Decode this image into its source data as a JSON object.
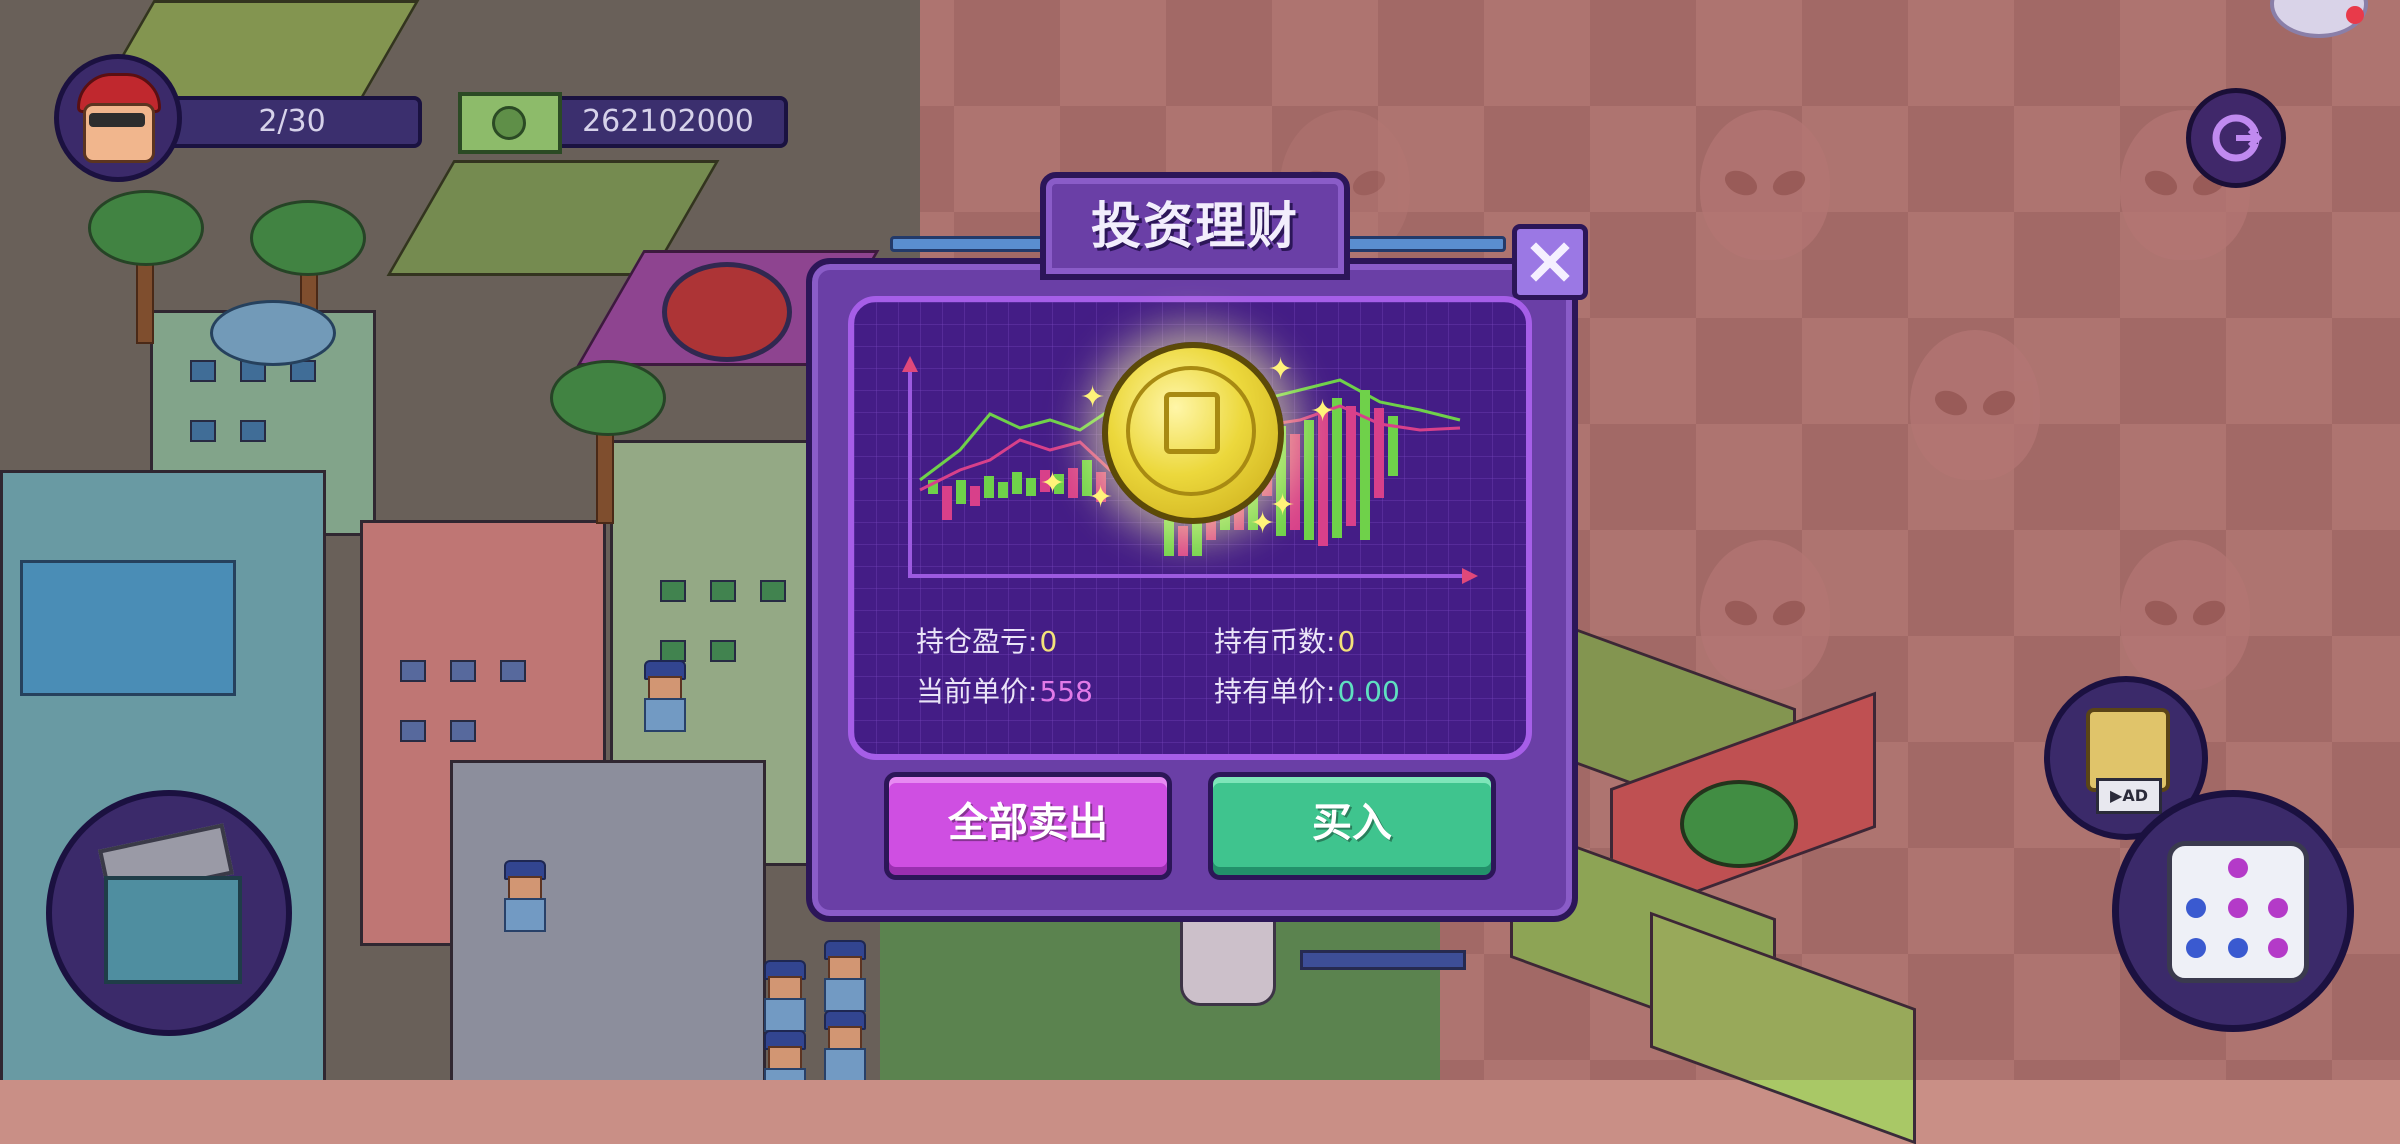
{
  "hud": {
    "turns": "2/30",
    "money": "262102000"
  },
  "dialog": {
    "title": "投资理财",
    "stats": {
      "pnl_label": "持仓盈亏:",
      "pnl_value": "0",
      "coins_label": "持有币数:",
      "coins_value": "0",
      "price_label": "当前单价:",
      "price_value": "558",
      "avg_label": "持有单价:",
      "avg_value": "0.00"
    },
    "sell_all_label": "全部卖出",
    "buy_label": "买入"
  },
  "colors": {
    "panel": "#441d86",
    "sell": "#cf4fe2",
    "buy": "#3fc48e",
    "pnl": "#f3e27a",
    "price": "#e27ae8",
    "avg": "#5fe0c0"
  },
  "icons": {
    "avatar": "player-avatar",
    "money": "cash-icon",
    "exit": "exit-icon",
    "close": "close-icon",
    "coin": "coin-icon",
    "chest": "treasure-chest-icon",
    "dice_ad": "dice-ad-icon",
    "dice": "dice-icon"
  }
}
